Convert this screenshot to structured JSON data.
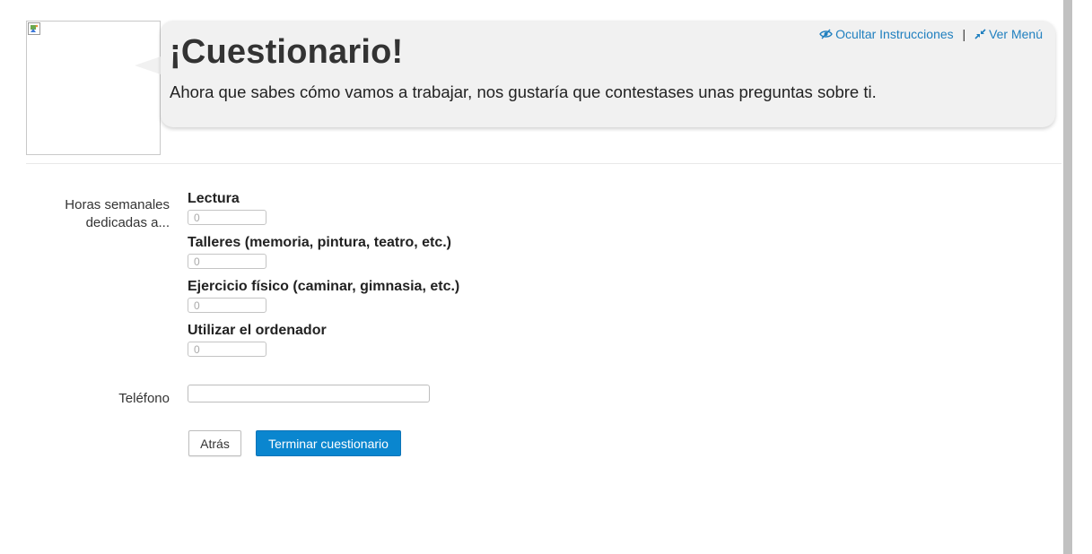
{
  "header": {
    "title": "¡Cuestionario!",
    "message": "Ahora que sabes cómo vamos a trabajar, nos gustaría que contestases unas preguntas sobre ti.",
    "hide_instructions_label": "Ocultar Instrucciones",
    "separator": "|",
    "show_menu_label": "Ver Menú"
  },
  "form": {
    "hours_label": "Horas semanales dedicadas a...",
    "fields": [
      {
        "label": "Lectura",
        "placeholder": "0"
      },
      {
        "label": "Talleres (memoria, pintura, teatro, etc.)",
        "placeholder": "0"
      },
      {
        "label": "Ejercicio físico (caminar, gimnasia, etc.)",
        "placeholder": "0"
      },
      {
        "label": "Utilizar el ordenador",
        "placeholder": "0"
      }
    ],
    "phone_label": "Teléfono",
    "phone_value": ""
  },
  "buttons": {
    "back_label": "Atrás",
    "finish_label": "Terminar cuestionario"
  },
  "colors": {
    "link": "#1f7fbf",
    "primary_button": "#0a86cf",
    "bubble_bg": "#f1f1f1"
  },
  "icons": {
    "hide_instructions": "eye-slash-icon",
    "show_menu": "compress-arrows-icon",
    "avatar": "broken-image-icon"
  }
}
